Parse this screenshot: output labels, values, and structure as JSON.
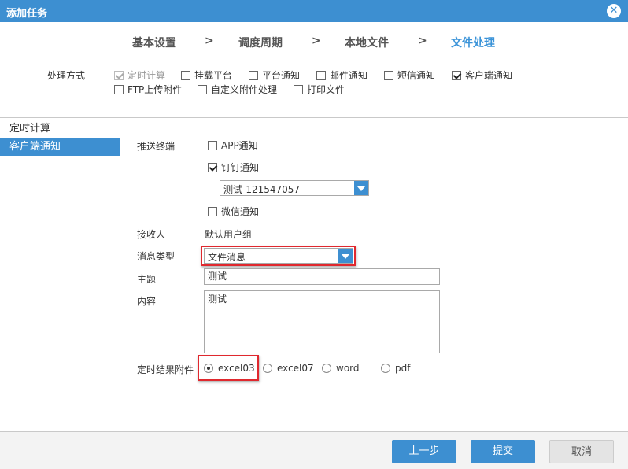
{
  "window": {
    "title": "添加任务",
    "close_glyph": "✕"
  },
  "steps": {
    "s1": "基本设置",
    "s2": "调度周期",
    "s3": "本地文件",
    "s4": "文件处理",
    "sep": ">"
  },
  "processing": {
    "label": "处理方式",
    "options": [
      {
        "label": "定时计算",
        "checked": true,
        "disabled": true
      },
      {
        "label": "挂载平台",
        "checked": false
      },
      {
        "label": "平台通知",
        "checked": false
      },
      {
        "label": "邮件通知",
        "checked": false
      },
      {
        "label": "短信通知",
        "checked": false
      },
      {
        "label": "客户端通知",
        "checked": true
      },
      {
        "label": "FTP上传附件",
        "checked": false
      },
      {
        "label": "自定义附件处理",
        "checked": false
      },
      {
        "label": "打印文件",
        "checked": false
      }
    ]
  },
  "sidebar": {
    "items": [
      {
        "label": "定时计算"
      },
      {
        "label": "客户端通知",
        "selected": true
      }
    ]
  },
  "form": {
    "push_label": "推送终端",
    "app_label": "APP通知",
    "dingtalk_label": "钉钉通知",
    "dingtalk_select": "测试-121547057",
    "wechat_label": "微信通知",
    "receiver_label": "接收人",
    "receiver_value": "默认用户组",
    "msgtype_label": "消息类型",
    "msgtype_value": "文件消息",
    "subject_label": "主题",
    "subject_value": "测试",
    "content_label": "内容",
    "content_value": "测试",
    "attach_label": "定时结果附件",
    "attach_options": [
      "excel03",
      "excel07",
      "word",
      "pdf"
    ],
    "attach_selected": "excel03"
  },
  "buttons": {
    "prev": "上一步",
    "submit": "提交",
    "cancel": "取消"
  },
  "colors": {
    "accent": "#3d8fd1",
    "highlight": "#e0282e"
  }
}
